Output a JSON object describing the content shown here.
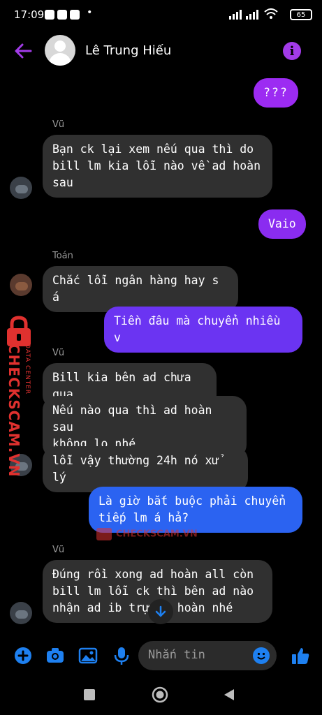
{
  "status_bar": {
    "time": "17:09",
    "battery": "65"
  },
  "header": {
    "contact_name": "Lê Trung Hiếu"
  },
  "messages": [
    {
      "type": "out",
      "text": "???"
    },
    {
      "type": "sender",
      "text": "Vũ"
    },
    {
      "type": "in",
      "text": "Bạn ck lại xem nếu qua thì do\nbill lm kia lỗi nào về ad hoàn\nsau"
    },
    {
      "type": "out",
      "text": "Vaio"
    },
    {
      "type": "sender",
      "text": "Toán"
    },
    {
      "type": "in",
      "text": "Chắc lỗi ngân hàng hay s á"
    },
    {
      "type": "out",
      "text": "Tiền đâu mà chuyển nhiều v"
    },
    {
      "type": "sender",
      "text": "Vũ"
    },
    {
      "type": "in",
      "text": "Bill kia bên ad chưa qua"
    },
    {
      "type": "in",
      "text": "Nếu nào qua thì ad hoàn sau\nkhông lo nhé"
    },
    {
      "type": "in",
      "text": "lỗi vậy thường 24h nó xử lý"
    },
    {
      "type": "out",
      "text": "Là giờ bắt buộc phải chuyển\ntiếp lm á hả?"
    },
    {
      "type": "sender",
      "text": "Vũ"
    },
    {
      "type": "in",
      "text": "Đúng rồi xong ad hoàn all còn\nbill lm lỗi ck thì bên ad nào\nnhận ad ib trự   ếp hoàn nhé"
    }
  ],
  "watermark": {
    "brand": "CHECKSCAM.VN",
    "tagline": "DATA CENTER"
  },
  "composer": {
    "placeholder": "Nhắn tin"
  },
  "colors": {
    "accent": "#a23be8",
    "outgoing_top": "#9c2bf2",
    "outgoing_bottom": "#1f6ef0",
    "incoming": "#303030",
    "icon_blue": "#1e80f0"
  }
}
